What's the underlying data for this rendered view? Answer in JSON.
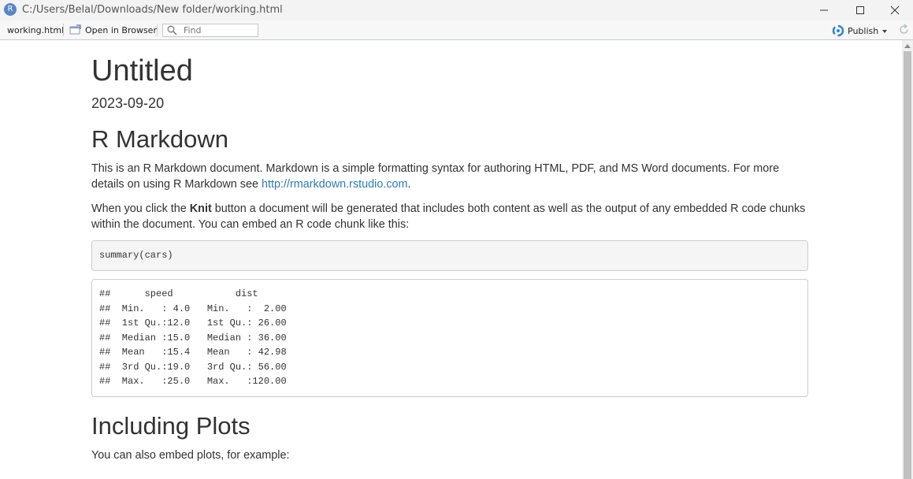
{
  "window": {
    "app_icon_letter": "R",
    "title": "C:/Users/Belal/Downloads/New folder/working.html"
  },
  "toolbar": {
    "file_name": "working.html",
    "open_browser_label": "Open in Browser",
    "find_placeholder": "Find",
    "publish_label": "Publish"
  },
  "document": {
    "title": "Untitled",
    "date": "2023-09-20",
    "section1": {
      "heading": "R Markdown",
      "para1_text": "This is an R Markdown document. Markdown is a simple formatting syntax for authoring HTML, PDF, and MS Word documents. For more details on using R Markdown see ",
      "para1_link": "http://rmarkdown.rstudio.com",
      "para1_end": ".",
      "para2_before": "When you click the ",
      "para2_bold": "Knit",
      "para2_after": " button a document will be generated that includes both content as well as the output of any embedded R code chunks within the document. You can embed an R code chunk like this:",
      "code": "summary(cars)",
      "output": "##      speed           dist       \n##  Min.   : 4.0   Min.   :  2.00  \n##  1st Qu.:12.0   1st Qu.: 26.00  \n##  Median :15.0   Median : 36.00  \n##  Mean   :15.4   Mean   : 42.98  \n##  3rd Qu.:19.0   3rd Qu.: 56.00  \n##  Max.   :25.0   Max.   :120.00  "
    },
    "section2": {
      "heading": "Including Plots",
      "para": "You can also embed plots, for example:"
    }
  }
}
